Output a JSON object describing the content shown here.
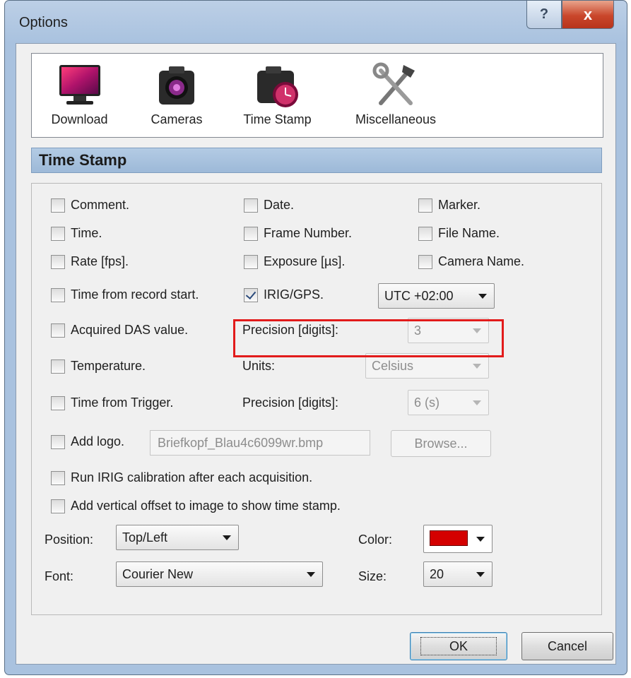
{
  "window": {
    "title": "Options",
    "help_glyph": "?",
    "close_glyph": "x"
  },
  "toolbar": {
    "items": [
      {
        "label": "Download",
        "icon": "monitor-icon"
      },
      {
        "label": "Cameras",
        "icon": "camera-icon"
      },
      {
        "label": "Time Stamp",
        "icon": "camera-clock-icon"
      },
      {
        "label": "Miscellaneous",
        "icon": "tools-icon"
      }
    ]
  },
  "section": {
    "title": "Time Stamp"
  },
  "checkboxes": {
    "comment": {
      "label": "Comment.",
      "checked": false
    },
    "date": {
      "label": "Date.",
      "checked": false
    },
    "marker": {
      "label": "Marker.",
      "checked": false
    },
    "time": {
      "label": "Time.",
      "checked": false
    },
    "frame_number": {
      "label": "Frame Number.",
      "checked": false
    },
    "file_name": {
      "label": "File Name.",
      "checked": false
    },
    "rate": {
      "label": "Rate [fps].",
      "checked": false
    },
    "exposure": {
      "label": "Exposure [µs].",
      "checked": false
    },
    "camera_name": {
      "label": "Camera Name.",
      "checked": false
    },
    "time_from_record_start": {
      "label": "Time from record start.",
      "checked": false
    },
    "irig_gps": {
      "label": "IRIG/GPS.",
      "checked": true
    },
    "acquired_das": {
      "label": "Acquired DAS value.",
      "checked": false
    },
    "temperature": {
      "label": "Temperature.",
      "checked": false
    },
    "time_from_trigger": {
      "label": "Time from Trigger.",
      "checked": false
    },
    "add_logo": {
      "label": "Add logo.",
      "checked": false
    },
    "run_irig_calibration": {
      "label": "Run IRIG calibration after each acquisition.",
      "checked": false
    },
    "add_vertical_offset": {
      "label": "Add vertical offset to image to show time stamp.",
      "checked": false
    }
  },
  "irig_timezone": {
    "value": "UTC +02:00"
  },
  "das_precision": {
    "label": "Precision [digits]:",
    "value": "3"
  },
  "temperature_units": {
    "label": "Units:",
    "value": "Celsius"
  },
  "trigger_precision": {
    "label": "Precision [digits]:",
    "value": "6 (s)"
  },
  "logo": {
    "file": "Briefkopf_Blau4c6099wr.bmp",
    "browse_label": "Browse..."
  },
  "position": {
    "label": "Position:",
    "value": "Top/Left"
  },
  "color": {
    "label": "Color:",
    "value": "#d40000"
  },
  "font": {
    "label": "Font:",
    "value": "Courier New"
  },
  "size": {
    "label": "Size:",
    "value": "20"
  },
  "buttons": {
    "ok": "OK",
    "cancel": "Cancel"
  }
}
